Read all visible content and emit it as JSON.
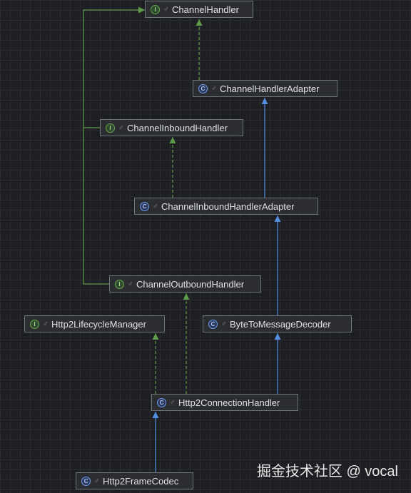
{
  "nodes": [
    {
      "id": "channel_handler",
      "label": "ChannelHandler",
      "kind": "interface"
    },
    {
      "id": "channel_handler_adapter",
      "label": "ChannelHandlerAdapter",
      "kind": "class"
    },
    {
      "id": "channel_inbound_handler",
      "label": "ChannelInboundHandler",
      "kind": "interface"
    },
    {
      "id": "channel_inbound_handler_adapter",
      "label": "ChannelInboundHandlerAdapter",
      "kind": "class"
    },
    {
      "id": "channel_outbound_handler",
      "label": "ChannelOutboundHandler",
      "kind": "interface"
    },
    {
      "id": "http2_lifecycle_manager",
      "label": "Http2LifecycleManager",
      "kind": "interface"
    },
    {
      "id": "byte_to_message_decoder",
      "label": "ByteToMessageDecoder",
      "kind": "class"
    },
    {
      "id": "http2_connection_handler",
      "label": "Http2ConnectionHandler",
      "kind": "class"
    },
    {
      "id": "http2_frame_codec",
      "label": "Http2FrameCodec",
      "kind": "class"
    }
  ],
  "edges": [
    {
      "from": "channel_handler_adapter",
      "to": "channel_handler",
      "type": "implements"
    },
    {
      "from": "channel_inbound_handler",
      "to": "channel_handler",
      "type": "extends-interface"
    },
    {
      "from": "channel_outbound_handler",
      "to": "channel_handler",
      "type": "extends-interface"
    },
    {
      "from": "channel_inbound_handler_adapter",
      "to": "channel_handler_adapter",
      "type": "extends"
    },
    {
      "from": "channel_inbound_handler_adapter",
      "to": "channel_inbound_handler",
      "type": "implements"
    },
    {
      "from": "byte_to_message_decoder",
      "to": "channel_inbound_handler_adapter",
      "type": "extends"
    },
    {
      "from": "http2_connection_handler",
      "to": "byte_to_message_decoder",
      "type": "extends"
    },
    {
      "from": "http2_connection_handler",
      "to": "http2_lifecycle_manager",
      "type": "implements"
    },
    {
      "from": "http2_connection_handler",
      "to": "channel_outbound_handler",
      "type": "implements"
    },
    {
      "from": "http2_frame_codec",
      "to": "http2_connection_handler",
      "type": "extends"
    }
  ],
  "kind_glyphs": {
    "interface": "I",
    "class": "C"
  },
  "visibility_glyph": "♂",
  "colors": {
    "interface_edge": "#5e9c4a",
    "class_edge": "#5590e0",
    "node_border": "#6f737a"
  },
  "watermark": "掘金技术社区 @ vocal"
}
